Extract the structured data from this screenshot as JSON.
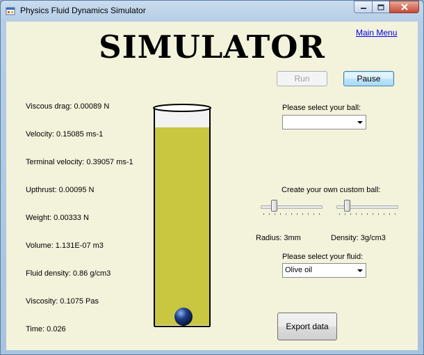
{
  "window": {
    "title": "Physics Fluid Dynamics Simulator",
    "icon": "app-icon"
  },
  "header": {
    "main_menu": "Main Menu",
    "title": "SIMULATOR"
  },
  "controls": {
    "run_label": "Run",
    "run_enabled": false,
    "pause_label": "Pause",
    "export_label": "Export data"
  },
  "stats": [
    "Viscous drag: 0.00089 N",
    "Velocity: 0.15085 ms-1",
    "Terminal velocity: 0.39057 ms-1",
    "Upthrust: 0.00095 N",
    "Weight: 0.00333 N",
    "Volume: 1.131E-07 m3",
    "Fluid density: 0.86 g/cm3",
    "Viscosity: 0.1075 Pas",
    "Time: 0.026"
  ],
  "ball_select": {
    "label": "Please select your ball:",
    "value": ""
  },
  "custom_ball": {
    "label": "Create your own custom ball:",
    "radius_label": "Radius: 3mm",
    "density_label": "Density: 3g/cm3",
    "radius_level": 0.2,
    "density_level": 0.15
  },
  "fluid_select": {
    "label": "Please select your fluid:",
    "value": "Olive oil"
  },
  "colors": {
    "fluid": "#c8c73f",
    "ball": "#1f3f8c",
    "background": "#f3f2db"
  }
}
